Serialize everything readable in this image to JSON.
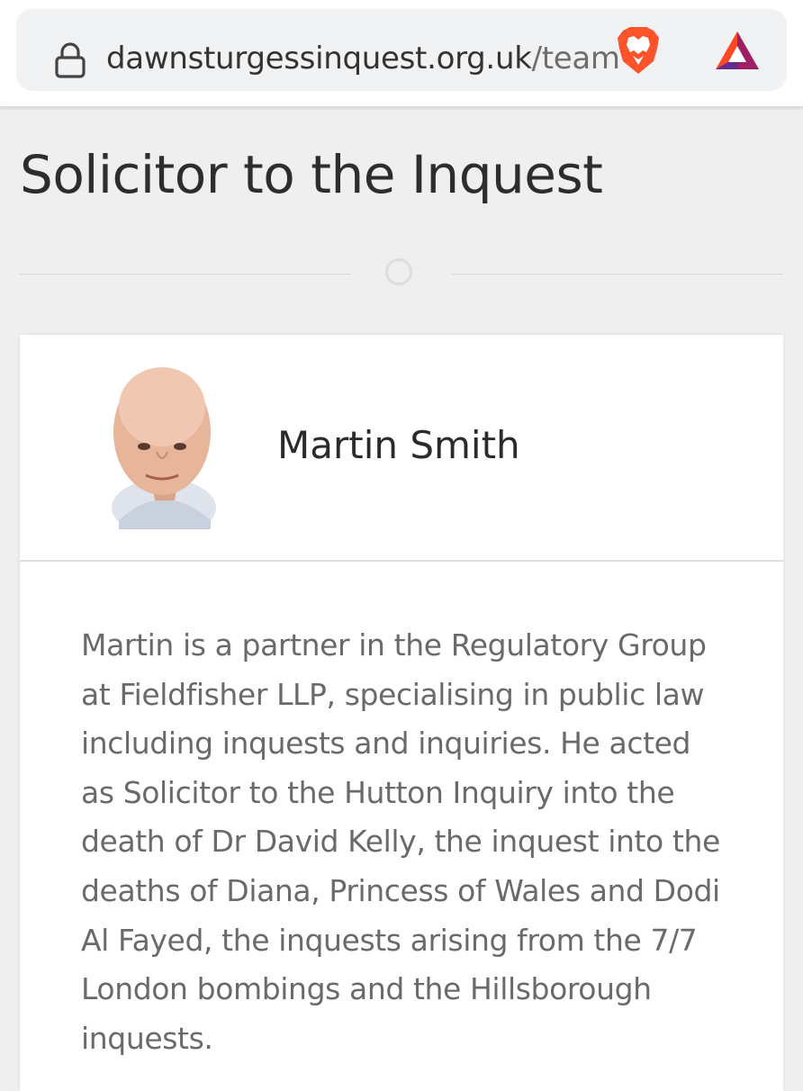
{
  "browser": {
    "url_domain": "dawnsturgessinquest.org.uk",
    "url_path": "/team",
    "icons": {
      "lock": "lock-icon",
      "brave": "brave-lion-icon",
      "rewards": "bat-triangle-icon"
    },
    "colors": {
      "brave_orange": "#fb542b",
      "bat_purple": "#662d91",
      "bat_red": "#ff4724"
    }
  },
  "section": {
    "title": "Solicitor to the Inquest"
  },
  "member": {
    "name": "Martin Smith",
    "bio": "Martin is a partner in the Regulatory Group at Fieldfisher LLP, specialising in public law including inquests and inquiries. He acted as Solicitor to the Hutton Inquiry into the death of Dr David Kelly, the inquest into the deaths of Diana, Princess of Wales and Dodi Al Fayed, the inquests arising from the 7/7 London bombings and the Hillsborough inquests."
  }
}
